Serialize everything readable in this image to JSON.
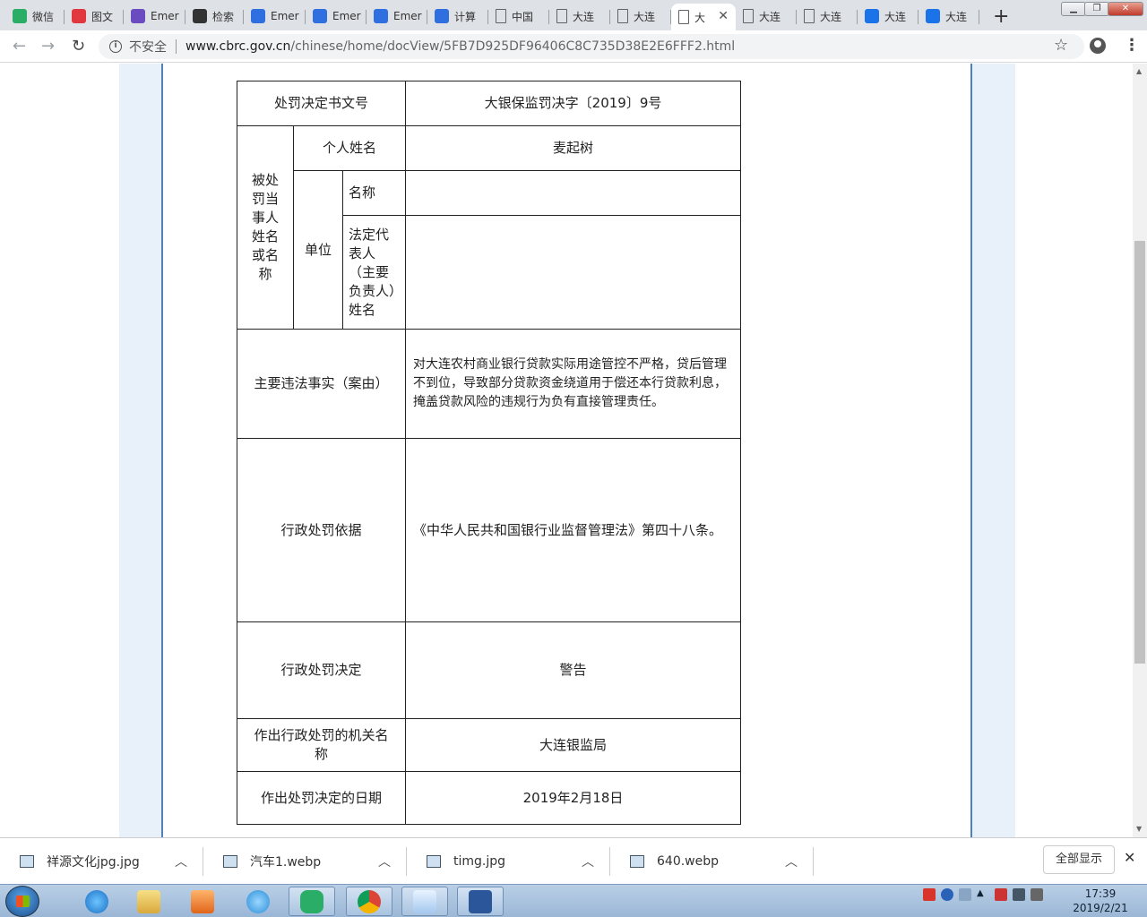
{
  "browser": {
    "tabs": [
      {
        "title": "微信",
        "icon": "wechat-icon",
        "color": "#2aae67"
      },
      {
        "title": "图文",
        "icon": "toutiao-icon",
        "color": "#e0383e"
      },
      {
        "title": "Emer",
        "icon": "infinity-icon",
        "color": "#6a4cc0"
      },
      {
        "title": "检索",
        "icon": "zhi-icon",
        "color": "#333333"
      },
      {
        "title": "Emer",
        "icon": "baidu-paw-icon",
        "color": "#2f6fe0"
      },
      {
        "title": "Emer",
        "icon": "baidu-paw-icon",
        "color": "#2f6fe0"
      },
      {
        "title": "Emer",
        "icon": "baidu-paw-icon",
        "color": "#2f6fe0"
      },
      {
        "title": "计算",
        "icon": "baidu-paw-icon",
        "color": "#2f6fe0"
      },
      {
        "title": "中国",
        "icon": "document-icon",
        "color": "#5f6368"
      },
      {
        "title": "大连",
        "icon": "document-icon",
        "color": "#5f6368"
      },
      {
        "title": "大连",
        "icon": "document-icon",
        "color": "#5f6368"
      },
      {
        "title": "大",
        "icon": "document-icon",
        "color": "#5f6368",
        "active": true
      },
      {
        "title": "大连",
        "icon": "document-icon",
        "color": "#5f6368"
      },
      {
        "title": "大连",
        "icon": "document-icon",
        "color": "#5f6368"
      },
      {
        "title": "大连",
        "icon": "edge-e-icon",
        "color": "#1a73e8"
      },
      {
        "title": "大连",
        "icon": "edge-e-icon",
        "color": "#1a73e8"
      }
    ],
    "security_label": "不安全",
    "url_host": "www.cbrc.gov.cn",
    "url_path": "/chinese/home/docView/5FB7D925DF96406C8C735D38E2E6FFF2.html"
  },
  "document": {
    "row1_label": "处罚决定书文号",
    "row1_value": "大银保监罚决字〔2019〕9号",
    "party_label": "被处罚当事人姓名或名称",
    "person_label": "个人姓名",
    "person_value": "麦起树",
    "unit_label": "单位",
    "unit_name_label": "名称",
    "unit_name_value": "",
    "legal_rep_label": "法定代表人（主要负责人）姓名",
    "legal_rep_value": "",
    "facts_label": "主要违法事实（案由）",
    "facts_value": "对大连农村商业银行贷款实际用途管控不严格，贷后管理不到位，导致部分贷款资金绕道用于偿还本行贷款利息，掩盖贷款风险的违规行为负有直接管理责任。",
    "basis_label": "行政处罚依据",
    "basis_value": "《中华人民共和国银行业监督管理法》第四十八条。",
    "decision_label": "行政处罚决定",
    "decision_value": "警告",
    "authority_label": "作出行政处罚的机关名称",
    "authority_value": "大连银监局",
    "date_label": "作出处罚决定的日期",
    "date_value": "2019年2月18日"
  },
  "downloads": {
    "items": [
      "祥源文化jpg.jpg",
      "汽车1.webp",
      "timg.jpg",
      "640.webp"
    ],
    "show_all": "全部显示"
  },
  "taskbar": {
    "time": "17:39",
    "date": "2019/2/21",
    "apps": [
      "internet-explorer-icon",
      "file-explorer-icon",
      "media-player-icon",
      "qq-browser-icon",
      "wechat-icon",
      "chrome-icon",
      "user-app-icon",
      "word-icon"
    ]
  }
}
